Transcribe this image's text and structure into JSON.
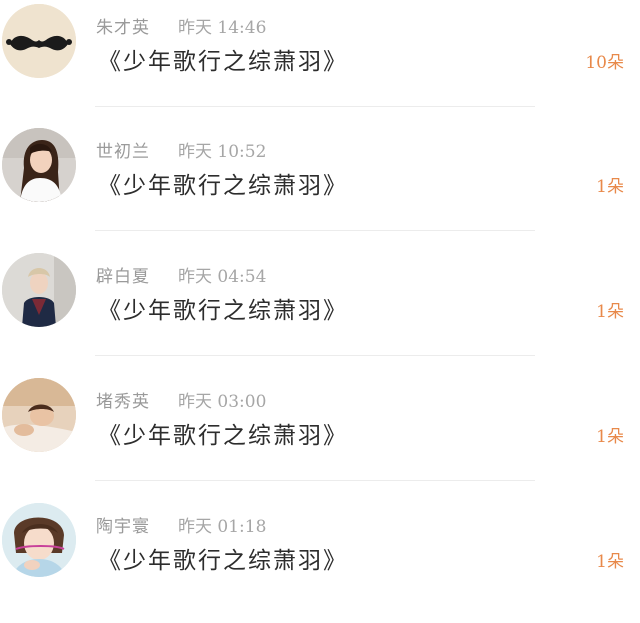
{
  "items": [
    {
      "name": "朱才英",
      "time": "昨天 14:46",
      "title": "《少年歌行之综萧羽》",
      "count": "10朵",
      "avatar_icon": "mustache-avatar"
    },
    {
      "name": "世初兰",
      "time": "昨天 10:52",
      "title": "《少年歌行之综萧羽》",
      "count": "1朵",
      "avatar_icon": "girl-photo-avatar"
    },
    {
      "name": "辟白夏",
      "time": "昨天 04:54",
      "title": "《少年歌行之综萧羽》",
      "count": "1朵",
      "avatar_icon": "boy-photo-avatar"
    },
    {
      "name": "堵秀英",
      "time": "昨天 03:00",
      "title": "《少年歌行之综萧羽》",
      "count": "1朵",
      "avatar_icon": "child-photo-avatar"
    },
    {
      "name": "陶宇寰",
      "time": "昨天 01:18",
      "title": "《少年歌行之综萧羽》",
      "count": "1朵",
      "avatar_icon": "selfie-photo-avatar"
    }
  ],
  "colors": {
    "count_accent": "#e8894a",
    "meta_gray": "#9a9a9a",
    "title_text": "#2d2d2d"
  }
}
